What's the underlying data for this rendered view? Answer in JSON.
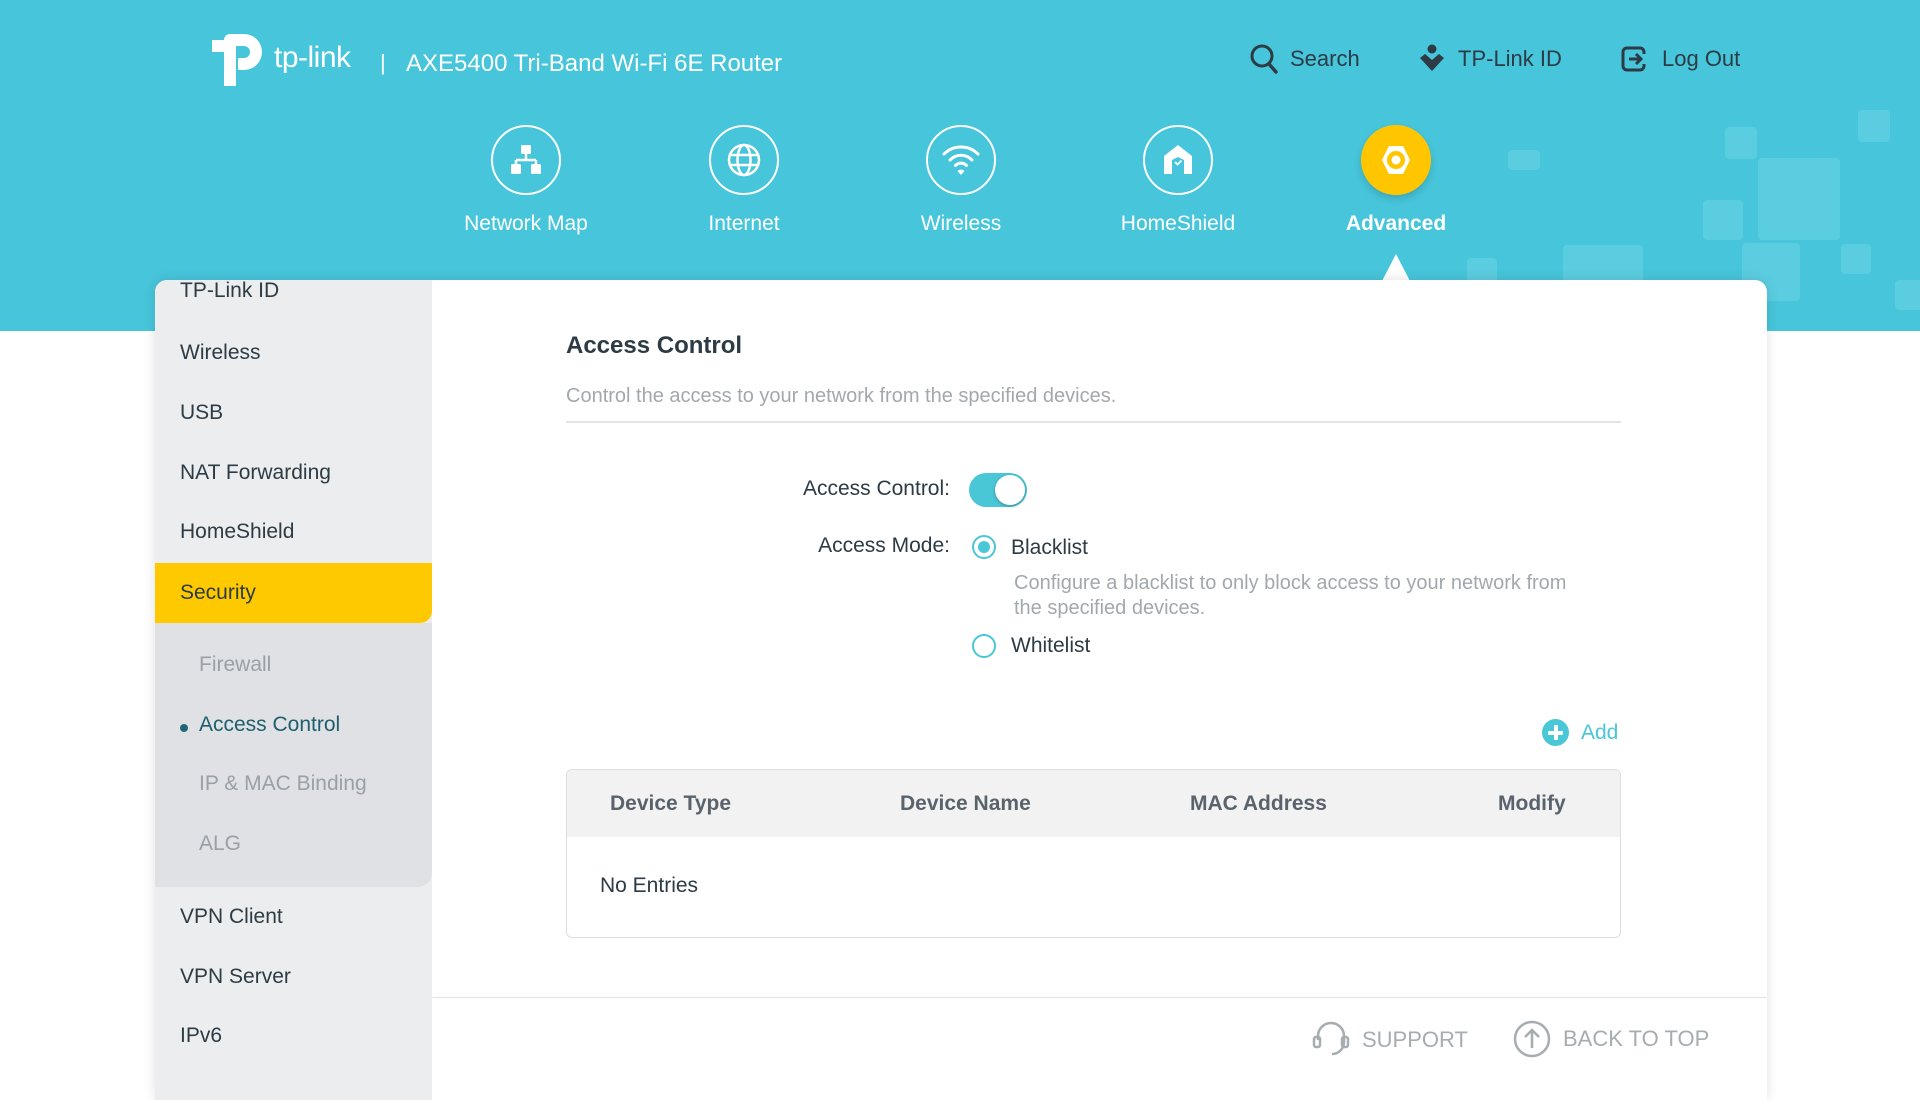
{
  "brand": {
    "logo_text": "tp-link",
    "separator": "|",
    "model": "AXE5400 Tri-Band Wi-Fi 6E Router"
  },
  "top_links": [
    {
      "icon": "search-icon",
      "label": "Search"
    },
    {
      "icon": "tplink-id-icon",
      "label": "TP-Link ID"
    },
    {
      "icon": "logout-icon",
      "label": "Log Out"
    }
  ],
  "nav": [
    {
      "icon": "network-map-icon",
      "label": "Network Map",
      "active": false
    },
    {
      "icon": "internet-globe-icon",
      "label": "Internet",
      "active": false
    },
    {
      "icon": "wifi-icon",
      "label": "Wireless",
      "active": false
    },
    {
      "icon": "homeshield-icon",
      "label": "HomeShield",
      "active": false
    },
    {
      "icon": "advanced-gear-icon",
      "label": "Advanced",
      "active": true
    }
  ],
  "sidebar": {
    "items": [
      {
        "label": "TP-Link ID"
      },
      {
        "label": "Wireless"
      },
      {
        "label": "USB"
      },
      {
        "label": "NAT Forwarding"
      },
      {
        "label": "HomeShield"
      },
      {
        "label": "Security",
        "active": true
      },
      {
        "label": "VPN Client"
      },
      {
        "label": "VPN Server"
      },
      {
        "label": "IPv6"
      }
    ],
    "security_sub": [
      {
        "label": "Firewall"
      },
      {
        "label": "Access Control",
        "current": true
      },
      {
        "label": "IP & MAC Binding"
      },
      {
        "label": "ALG"
      }
    ]
  },
  "main": {
    "title": "Access Control",
    "description": "Control the access to your network from the specified devices.",
    "access_control_label": "Access Control:",
    "access_control_enabled": true,
    "access_mode_label": "Access Mode:",
    "modes": [
      {
        "label": "Blacklist",
        "selected": true,
        "description": "Configure a blacklist to only block access to your network from the specified devices."
      },
      {
        "label": "Whitelist",
        "selected": false
      }
    ],
    "add_label": "Add",
    "table": {
      "columns": [
        "Device Type",
        "Device Name",
        "MAC Address",
        "Modify"
      ],
      "rows": [],
      "empty_text": "No Entries"
    }
  },
  "footer": {
    "support": "SUPPORT",
    "back_to_top": "BACK TO TOP"
  },
  "colors": {
    "header_bg": "#47c5db",
    "accent": "#4ac7d7",
    "active_yellow": "#ffc900"
  }
}
